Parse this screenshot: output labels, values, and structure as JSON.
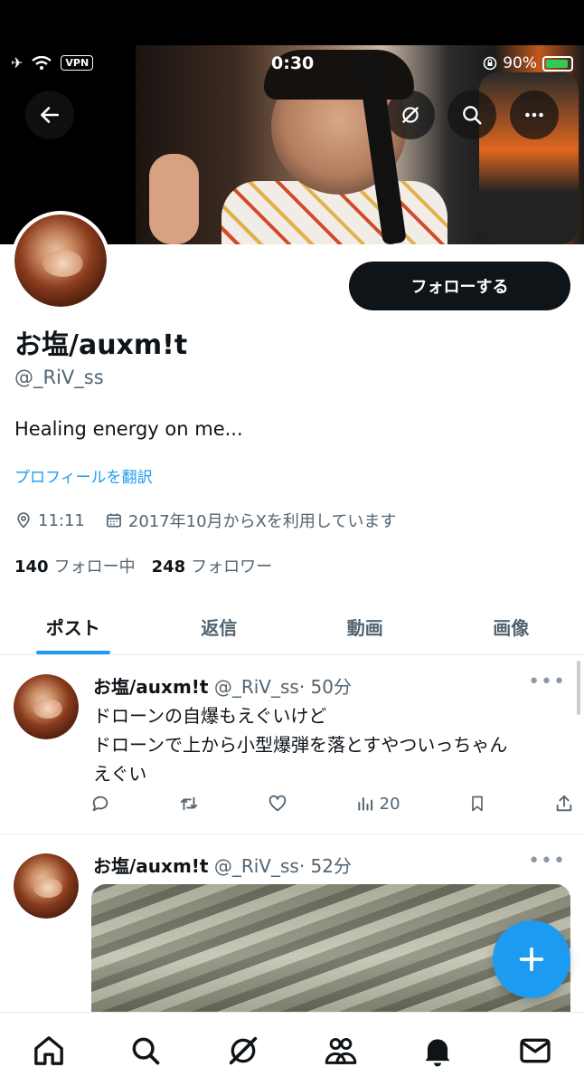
{
  "status_bar": {
    "time": "0:30",
    "vpn_label": "VPN",
    "battery": "90%",
    "icons": [
      "airplane-icon",
      "wifi-icon",
      "orientation-lock-icon",
      "battery-charging-icon"
    ]
  },
  "header": {
    "icons": [
      "back-arrow-icon",
      "grok-icon",
      "search-icon",
      "more-icon"
    ]
  },
  "profile": {
    "display_name": "お塩/auxm!t",
    "handle": "@_RiV_ss",
    "follow_button": "フォローする",
    "bio": "Healing energy on me...",
    "translate_link": "プロフィールを翻訳",
    "location": "11:11",
    "joined": "2017年10月からXを利用しています",
    "following_count": "140",
    "following_label": "フォロー中",
    "followers_count": "248",
    "followers_label": "フォロワー"
  },
  "tabs": [
    {
      "label": "ポスト",
      "active": true
    },
    {
      "label": "返信",
      "active": false
    },
    {
      "label": "動画",
      "active": false
    },
    {
      "label": "画像",
      "active": false
    }
  ],
  "posts": [
    {
      "author": "お塩/auxm!t",
      "handle": "@_RiV_ss",
      "time": "· 50分",
      "text": "ドローンの自爆もえぐいけど\nドローンで上から小型爆弾を落とすやついっちゃん\nえぐい",
      "views": "20"
    },
    {
      "author": "お塩/auxm!t",
      "handle": "@_RiV_ss",
      "time": "· 52分",
      "has_media": true
    }
  ],
  "more_glyph": "•••",
  "bottom_nav": [
    "home-icon",
    "search-icon",
    "grok-icon",
    "communities-icon",
    "notifications-icon",
    "messages-icon"
  ],
  "colors": {
    "accent": "#1d9bf0",
    "text_primary": "#0f1419",
    "text_secondary": "#536471",
    "follow_button_bg": "#0f1419"
  }
}
